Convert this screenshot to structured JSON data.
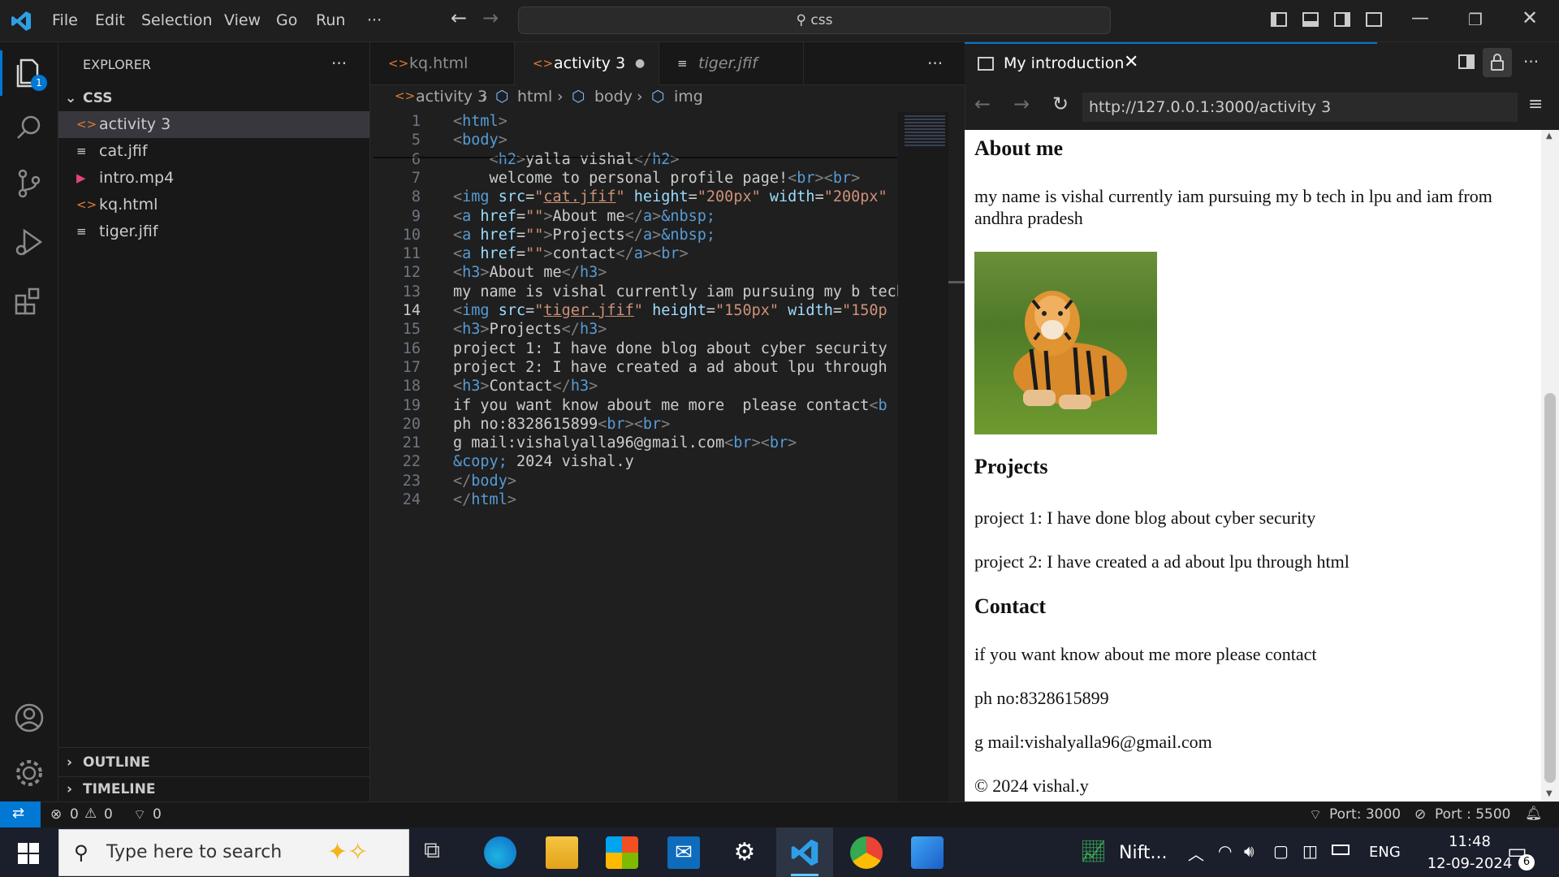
{
  "titlebar": {
    "menu": [
      "File",
      "Edit",
      "Selection",
      "View",
      "Go",
      "Run"
    ],
    "more": "···",
    "search": "css"
  },
  "activity_bar": {
    "badge": "1"
  },
  "sidebar": {
    "title": "EXPLORER",
    "more": "···",
    "folder": "CSS",
    "files": [
      {
        "name": "activity 3",
        "icon": "html-file-icon",
        "icon_glyph": "<>",
        "icon_color": "#e37933"
      },
      {
        "name": "cat.jfif",
        "icon": "plain-file-icon",
        "icon_glyph": "≡",
        "icon_color": "#cccccc"
      },
      {
        "name": "intro.mp4",
        "icon": "video-file-icon",
        "icon_glyph": "▶",
        "icon_color": "#e0457b"
      },
      {
        "name": "kq.html",
        "icon": "html-file-icon",
        "icon_glyph": "<>",
        "icon_color": "#e37933"
      },
      {
        "name": "tiger.jfif",
        "icon": "plain-file-icon",
        "icon_glyph": "≡",
        "icon_color": "#cccccc"
      }
    ],
    "sections": [
      "OUTLINE",
      "TIMELINE"
    ]
  },
  "editor": {
    "tabs": [
      {
        "label": "kq.html"
      },
      {
        "label": "activity 3"
      },
      {
        "label": "tiger.jfif"
      }
    ],
    "more": "···",
    "breadcrumb": [
      "activity 3",
      "html",
      "body",
      "img"
    ],
    "current_line": "14",
    "lines": [
      {
        "n": "1",
        "html": "<span class='br'>&lt;</span><span class='tag'>html</span><span class='br'>&gt;</span>"
      },
      {
        "n": "5",
        "html": "<span class='br'>&lt;</span><span class='tag'>body</span><span class='br'>&gt;</span>"
      },
      {
        "n": "6",
        "html": "    <span class='br'>&lt;</span><span class='tag'>h2</span><span class='br'>&gt;</span>yalla vishal<span class='br'>&lt;/</span><span class='tag'>h2</span><span class='br'>&gt;</span>"
      },
      {
        "n": "7",
        "html": "    welcome to personal profile page!<span class='br'>&lt;</span><span class='tag'>br</span><span class='br'>&gt;&lt;</span><span class='tag'>br</span><span class='br'>&gt;</span>"
      },
      {
        "n": "8",
        "html": "<span class='br'>&lt;</span><span class='tag'>img</span> <span class='attr'>src</span>=<span class='str'>\"<u>cat.jfif</u>\"</span> <span class='attr'>height</span>=<span class='str'>\"200px\"</span> <span class='attr'>width</span>=<span class='str'>\"200px\"</span>"
      },
      {
        "n": "9",
        "html": "<span class='br'>&lt;</span><span class='tag'>a</span> <span class='attr'>href</span>=<span class='str'>\"\"</span><span class='br'>&gt;</span>About me<span class='br'>&lt;/</span><span class='tag'>a</span><span class='br'>&gt;</span><span class='ent'>&amp;nbsp;</span>"
      },
      {
        "n": "10",
        "html": "<span class='br'>&lt;</span><span class='tag'>a</span> <span class='attr'>href</span>=<span class='str'>\"\"</span><span class='br'>&gt;</span>Projects<span class='br'>&lt;/</span><span class='tag'>a</span><span class='br'>&gt;</span><span class='ent'>&amp;nbsp;</span>"
      },
      {
        "n": "11",
        "html": "<span class='br'>&lt;</span><span class='tag'>a</span> <span class='attr'>href</span>=<span class='str'>\"\"</span><span class='br'>&gt;</span>contact<span class='br'>&lt;/</span><span class='tag'>a</span><span class='br'>&gt;&lt;</span><span class='tag'>br</span><span class='br'>&gt;</span>"
      },
      {
        "n": "12",
        "html": "<span class='br'>&lt;</span><span class='tag'>h3</span><span class='br'>&gt;</span>About me<span class='br'>&lt;/</span><span class='tag'>h3</span><span class='br'>&gt;</span>"
      },
      {
        "n": "13",
        "html": "my name is vishal currently iam pursuing my b tech"
      },
      {
        "n": "14",
        "html": "<span class='br'>&lt;</span><span class='tag'>img</span> <span class='attr'>src</span>=<span class='str'>\"<u>tiger.jfif</u>\"</span> <span class='attr'>height</span>=<span class='str'>\"150px\"</span> <span class='attr'>width</span>=<span class='str'>\"150p</span>"
      },
      {
        "n": "15",
        "html": "<span class='br'>&lt;</span><span class='tag'>h3</span><span class='br'>&gt;</span>Projects<span class='br'>&lt;/</span><span class='tag'>h3</span><span class='br'>&gt;</span>"
      },
      {
        "n": "16",
        "html": "project 1: I have done blog about cyber security"
      },
      {
        "n": "17",
        "html": "project 2: I have created a ad about lpu through"
      },
      {
        "n": "18",
        "html": "<span class='br'>&lt;</span><span class='tag'>h3</span><span class='br'>&gt;</span>Contact<span class='br'>&lt;/</span><span class='tag'>h3</span><span class='br'>&gt;</span>"
      },
      {
        "n": "19",
        "html": "if you want know about me more  please contact<span class='br'>&lt;</span><span class='tag'>b</span>"
      },
      {
        "n": "20",
        "html": "ph no:8328615899<span class='br'>&lt;</span><span class='tag'>br</span><span class='br'>&gt;&lt;</span><span class='tag'>br</span><span class='br'>&gt;</span>"
      },
      {
        "n": "21",
        "html": "g mail:vishalyalla96@gmail.com<span class='br'>&lt;</span><span class='tag'>br</span><span class='br'>&gt;&lt;</span><span class='tag'>br</span><span class='br'>&gt;</span>"
      },
      {
        "n": "22",
        "html": "<span class='ent'>&amp;copy;</span> 2024 vishal.y"
      },
      {
        "n": "23",
        "html": "<span class='br'>&lt;/</span><span class='tag'>body</span><span class='br'>&gt;</span>"
      },
      {
        "n": "24",
        "html": "<span class='br'>&lt;/</span><span class='tag'>html</span><span class='br'>&gt;</span>"
      }
    ]
  },
  "preview": {
    "tab_title": "My introduction",
    "url": "http://127.0.0.1:3000/activity 3",
    "page": {
      "about_heading": "About me",
      "about_text": "my name is vishal currently iam pursuing my b tech in lpu and iam from andhra pradesh",
      "projects_heading": "Projects",
      "project1": "project 1: I have done blog about cyber security",
      "project2": "project 2: I have created a ad about lpu through html",
      "contact_heading": "Contact",
      "contact_text": "if you want know about me more please contact",
      "phone": "ph no:8328615899",
      "email": "g mail:vishalyalla96@gmail.com",
      "copyright": "© 2024 vishal.y"
    }
  },
  "statusbar": {
    "errors": "0",
    "warnings": "0",
    "ports_count": "0",
    "port1": "Port: 3000",
    "port2": "Port : 5500"
  },
  "taskbar": {
    "search_placeholder": "Type here to search",
    "stock": "Nift...",
    "lang": "ENG",
    "time": "11:48",
    "date": "12-09-2024",
    "notif": "6"
  },
  "colors": {
    "accent": "#0078d4",
    "taskbar": "#1a1f2b",
    "editor_bg": "#1f1f1f"
  }
}
